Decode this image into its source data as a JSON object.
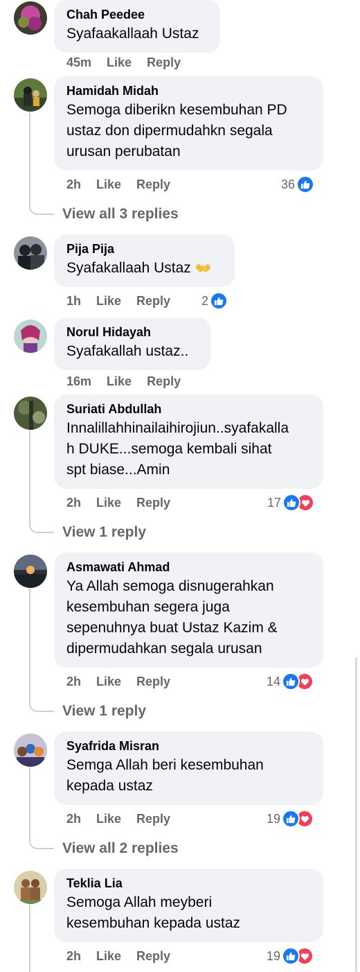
{
  "comments": [
    {
      "name": "Chah Peedee",
      "text": "Syafaakallaah Ustaz",
      "time": "45m",
      "like": "Like",
      "reply": "Reply"
    },
    {
      "name": "Hamidah Midah",
      "text": "Semoga diberikn kesembuhan PD\nustaz don dipermudahkn segala\nurusan perubatan",
      "time": "2h",
      "like": "Like",
      "reply": "Reply",
      "reactions": "36",
      "view": "View all 3 replies"
    },
    {
      "name": "Pija Pija",
      "text": "Syafakallaah Ustaz",
      "emoji": "👐",
      "time": "1h",
      "like": "Like",
      "reply": "Reply",
      "reactions": "2"
    },
    {
      "name": "Norul Hidayah",
      "text": "Syafakallah ustaz..",
      "time": "16m",
      "like": "Like",
      "reply": "Reply"
    },
    {
      "name": "Suriati Abdullah",
      "text": "Innalillahhinailaihirojiun..syafakalla\nh DUKE...semoga kembali sihat\nspt biase...Amin",
      "time": "2h",
      "like": "Like",
      "reply": "Reply",
      "reactions": "17",
      "view": "View 1 reply"
    },
    {
      "name": "Asmawati Ahmad",
      "text": "Ya Allah semoga disnugerahkan\nkesembuhan segera juga\nsepenuhnya buat Ustaz Kazim &\ndipermudahkan segala urusan",
      "time": "2h",
      "like": "Like",
      "reply": "Reply",
      "reactions": "14",
      "view": "View 1 reply"
    },
    {
      "name": "Syafrida Misran",
      "text": "Semga Allah beri kesembuhan\nkepada ustaz",
      "time": "2h",
      "like": "Like",
      "reply": "Reply",
      "reactions": "19",
      "view": "View all 2 replies"
    },
    {
      "name": "Teklia Lia",
      "text": "Semoga Allah meyberi\nkesembuhan kepada ustaz",
      "time": "2h",
      "like": "Like",
      "reply": "Reply",
      "reactions": "19"
    }
  ],
  "icons": {
    "like": "thumbs-up-icon",
    "love": "heart-icon"
  },
  "colors": {
    "like": "#1877f2",
    "love": "#f33e58",
    "bubble": "#f0f2f5",
    "meta": "#65676b"
  }
}
